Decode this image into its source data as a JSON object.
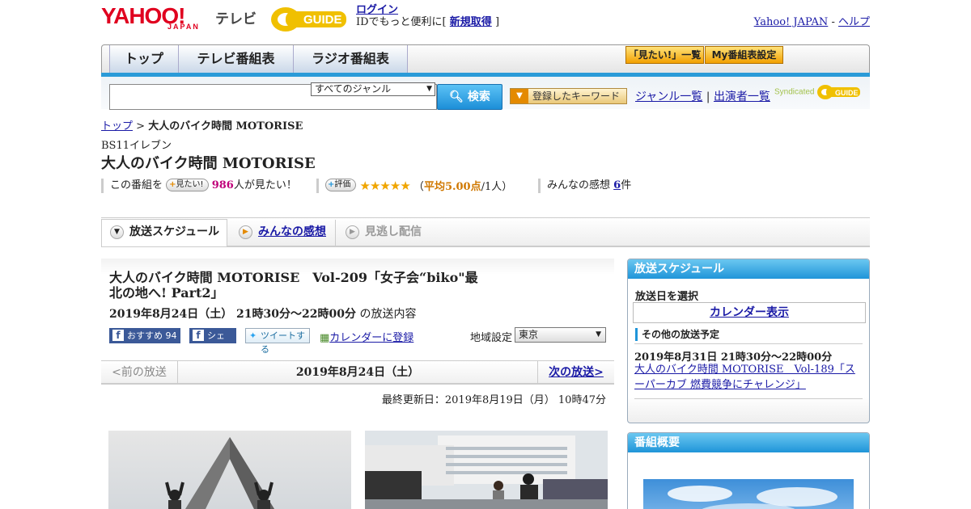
{
  "header": {
    "yahoo_logo": "YAHOO!",
    "yahoo_sub": "JAPAN",
    "tv_label": "テレビ",
    "gguide_logo": "GUIDE",
    "login": "ログイン",
    "login_desc": "IDでもっと便利に[",
    "signup": "新規取得",
    "signup_close": "]",
    "yahoo_japan_link": "Yahoo! JAPAN",
    "separator": "-",
    "help_link": "ヘルプ"
  },
  "nav": {
    "tabs": [
      "トップ",
      "テレビ番組表",
      "ラジオ番組表"
    ],
    "want_list": "「見たい!」一覧",
    "my_schedule": "My番組表設定"
  },
  "search": {
    "genre": "すべてのジャンル",
    "search_button": "検索",
    "keyword_button": "登録したキーワード",
    "genre_list": "ジャンル一覧",
    "divider": "|",
    "cast_list": "出演者一覧",
    "syndicated": "Syndicated"
  },
  "program": {
    "breadcrumb_top": "トップ",
    "breadcrumb_sep": ">",
    "breadcrumb_current": "大人のバイク時間 MOTORISE",
    "channel": "BS11イレブン",
    "title": "大人のバイク時間 MOTORISE",
    "this_program": "この番組を",
    "want_button": "見たい!",
    "want_count": "986",
    "want_suffix": "人が見たい！",
    "rating_button": "評価",
    "stars": "★★★★★",
    "rating_open": "（",
    "rating_avg": "平均5.00点",
    "rating_count": "/1人）",
    "impressions_label": "みんなの感想",
    "impressions_count": "6",
    "impressions_suffix": "件"
  },
  "subtabs": {
    "schedule": "放送スケジュール",
    "impressions": "みんなの感想",
    "missed": "見逃し配信"
  },
  "episode": {
    "title": "大人のバイク時間 MOTORISE　Vol-209「女子会“biko\"最北の地へ! Part2」",
    "datetime": "2019年8月24日（土）  21時30分～22時00分",
    "datetime_suffix": "の放送内容",
    "recommend": "おすすめ",
    "recommend_count": "94",
    "share": "シェア",
    "tweet": "ツイートする",
    "calendar_register": "カレンダーに登録",
    "region_label": "地域設定",
    "region": "東京",
    "prev": "<前の放送",
    "date": "2019年8月24日（土）",
    "next": "次の放送>",
    "updated": "最終更新日：2019年8月19日（月）  10時47分"
  },
  "sidebar": {
    "schedule_header": "放送スケジュール",
    "select_date": "放送日を選択",
    "calendar_button": "カレンダー表示",
    "other_label": "その他の放送予定",
    "other_time": "2019年8月31日  21時30分～22時00分",
    "other_link": "大人のバイク時間 MOTORISE　Vol-189「スーパーカブ 燃費競争にチャレンジ」",
    "summary_header": "番組概要"
  },
  "colors": {
    "accent": "#1f95d9",
    "yahoo_red": "#e0001f",
    "star": "#f0a500",
    "link": "#1a1aa6"
  }
}
